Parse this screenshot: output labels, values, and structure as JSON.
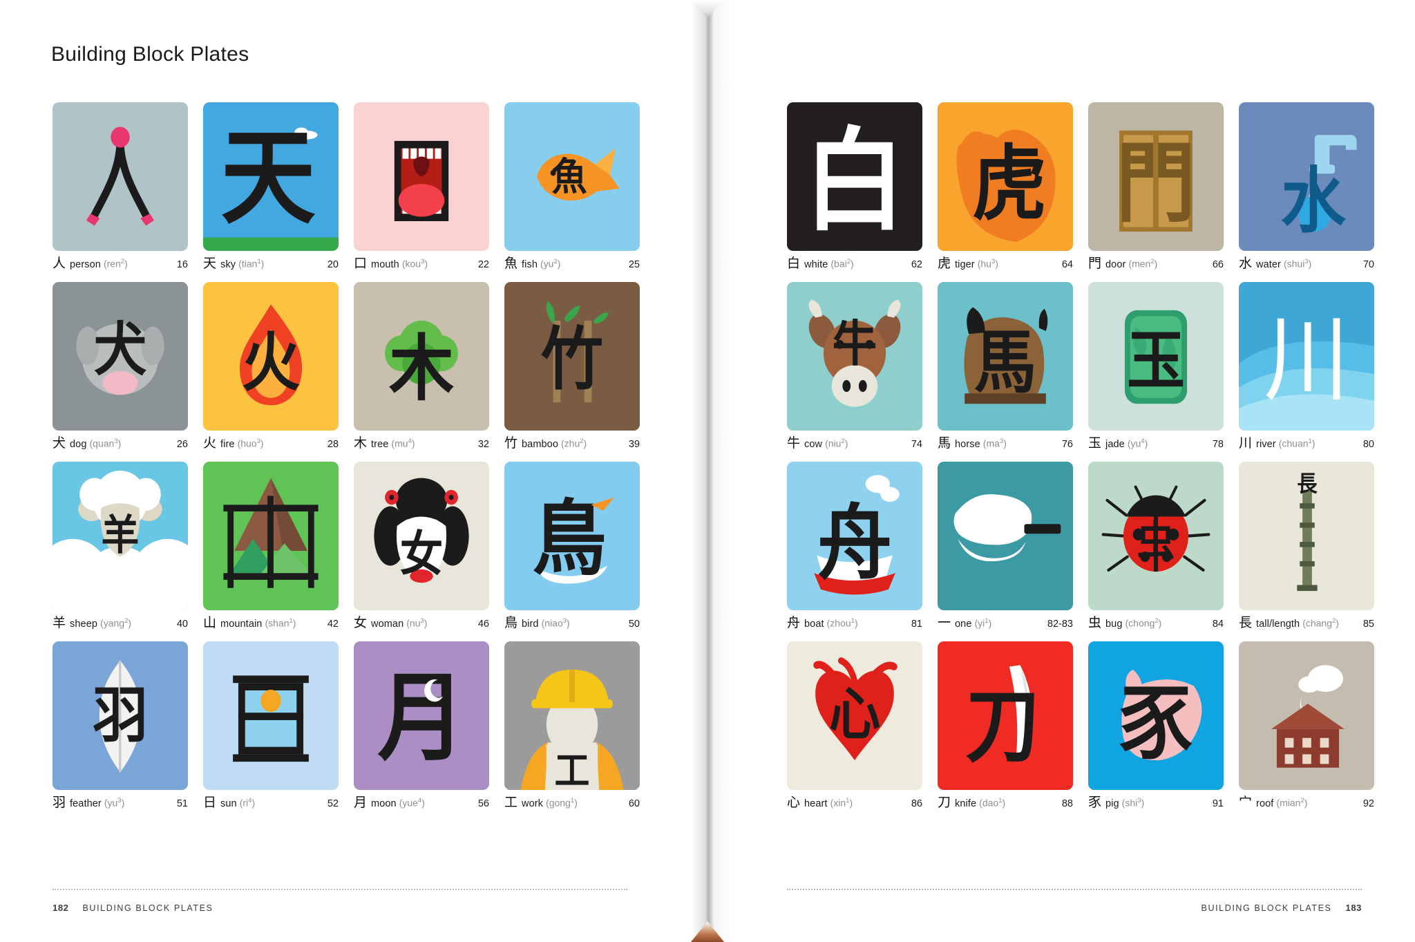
{
  "spread": {
    "title": "Building Block Plates",
    "left_page": {
      "folio": "182",
      "running_head": "BUILDING BLOCK PLATES"
    },
    "right_page": {
      "folio": "183",
      "running_head": "BUILDING BLOCK PLATES"
    }
  },
  "plates_left": [
    {
      "han": "人",
      "gloss": "person",
      "pinyin": "ren",
      "tone": "2",
      "page": "16",
      "icon": "person-tile",
      "bg": "#b0c3c6",
      "art": "person"
    },
    {
      "han": "天",
      "gloss": "sky",
      "pinyin": "tian",
      "tone": "1",
      "page": "20",
      "icon": "sky-tile",
      "bg": "#43a8e0",
      "art": "sky"
    },
    {
      "han": "口",
      "gloss": "mouth",
      "pinyin": "kou",
      "tone": "3",
      "page": "22",
      "icon": "mouth-tile",
      "bg": "#f9d3d2",
      "art": "mouth"
    },
    {
      "han": "魚",
      "gloss": "fish",
      "pinyin": "yu",
      "tone": "2",
      "page": "25",
      "icon": "fish-tile",
      "bg": "#87cdee",
      "art": "fish"
    },
    {
      "han": "犬",
      "gloss": "dog",
      "pinyin": "quan",
      "tone": "3",
      "page": "26",
      "icon": "dog-tile",
      "bg": "#8b9395",
      "art": "dog"
    },
    {
      "han": "火",
      "gloss": "fire",
      "pinyin": "huo",
      "tone": "3",
      "page": "28",
      "icon": "fire-tile",
      "bg": "#fbc33f",
      "art": "fire"
    },
    {
      "han": "木",
      "gloss": "tree",
      "pinyin": "mu",
      "tone": "4",
      "page": "32",
      "icon": "tree-tile",
      "bg": "#c9bfae",
      "art": "tree"
    },
    {
      "han": "竹",
      "gloss": "bamboo",
      "pinyin": "zhu",
      "tone": "2",
      "page": "39",
      "icon": "bamboo-tile",
      "bg": "#7a5c42",
      "art": "bamboo"
    },
    {
      "han": "羊",
      "gloss": "sheep",
      "pinyin": "yang",
      "tone": "2",
      "page": "40",
      "icon": "sheep-tile",
      "bg": "#69c6e4",
      "art": "sheep"
    },
    {
      "han": "山",
      "gloss": "mountain",
      "pinyin": "shan",
      "tone": "1",
      "page": "42",
      "icon": "mountain-tile",
      "bg": "#5fc356",
      "art": "mountain"
    },
    {
      "han": "女",
      "gloss": "woman",
      "pinyin": "nu",
      "tone": "3",
      "page": "46",
      "icon": "woman-tile",
      "bg": "#e8e5da",
      "art": "woman"
    },
    {
      "han": "鳥",
      "gloss": "bird",
      "pinyin": "niao",
      "tone": "3",
      "page": "50",
      "icon": "bird-tile",
      "bg": "#83ccf0",
      "art": "bird"
    },
    {
      "han": "羽",
      "gloss": "feather",
      "pinyin": "yu",
      "tone": "3",
      "page": "51",
      "icon": "feather-tile",
      "bg": "#7ba5d6",
      "art": "feather"
    },
    {
      "han": "日",
      "gloss": "sun",
      "pinyin": "ri",
      "tone": "4",
      "page": "52",
      "icon": "sun-tile",
      "bg": "#bfdcf4",
      "art": "sun"
    },
    {
      "han": "月",
      "gloss": "moon",
      "pinyin": "yue",
      "tone": "4",
      "page": "56",
      "icon": "moon-tile",
      "bg": "#ab8fc4",
      "art": "moon"
    },
    {
      "han": "工",
      "gloss": "work",
      "pinyin": "gong",
      "tone": "1",
      "page": "60",
      "icon": "work-tile",
      "bg": "#9b9b9b",
      "art": "work"
    }
  ],
  "plates_right": [
    {
      "han": "白",
      "gloss": "white",
      "pinyin": "bai",
      "tone": "2",
      "page": "62",
      "icon": "white-tile",
      "bg": "#231f20",
      "art": "white"
    },
    {
      "han": "虎",
      "gloss": "tiger",
      "pinyin": "hu",
      "tone": "3",
      "page": "64",
      "icon": "tiger-tile",
      "bg": "#f9a42c",
      "art": "tiger"
    },
    {
      "han": "門",
      "gloss": "door",
      "pinyin": "men",
      "tone": "2",
      "page": "66",
      "icon": "door-tile",
      "bg": "#bdb5a6",
      "art": "door"
    },
    {
      "han": "水",
      "gloss": "water",
      "pinyin": "shui",
      "tone": "3",
      "page": "70",
      "icon": "water-tile",
      "bg": "#6b8bbd",
      "art": "water"
    },
    {
      "han": "牛",
      "gloss": "cow",
      "pinyin": "niu",
      "tone": "2",
      "page": "74",
      "icon": "cow-tile",
      "bg": "#8ecfcd",
      "art": "cow"
    },
    {
      "han": "馬",
      "gloss": "horse",
      "pinyin": "ma",
      "tone": "3",
      "page": "76",
      "icon": "horse-tile",
      "bg": "#6cc0c9",
      "art": "horse"
    },
    {
      "han": "玉",
      "gloss": "jade",
      "pinyin": "yu",
      "tone": "4",
      "page": "78",
      "icon": "jade-tile",
      "bg": "#cde0dc",
      "art": "jade"
    },
    {
      "han": "川",
      "gloss": "river",
      "pinyin": "chuan",
      "tone": "1",
      "page": "80",
      "icon": "river-tile",
      "bg": "#3fa7d6",
      "art": "river"
    },
    {
      "han": "舟",
      "gloss": "boat",
      "pinyin": "zhou",
      "tone": "1",
      "page": "81",
      "icon": "boat-tile",
      "bg": "#8fd2ef",
      "art": "boat"
    },
    {
      "han": "一",
      "gloss": "one",
      "pinyin": "yi",
      "tone": "1",
      "page": "82-83",
      "icon": "one-tile",
      "bg": "#3b9aa4",
      "art": "one"
    },
    {
      "han": "虫",
      "gloss": "bug",
      "pinyin": "chong",
      "tone": "2",
      "page": "84",
      "icon": "bug-tile",
      "bg": "#bcd9c9",
      "art": "bug"
    },
    {
      "han": "長",
      "gloss": "tall/length",
      "pinyin": "chang",
      "tone": "2",
      "page": "85",
      "icon": "tall-length-tile",
      "bg": "#e9e6da",
      "art": "tall"
    },
    {
      "han": "心",
      "gloss": "heart",
      "pinyin": "xin",
      "tone": "1",
      "page": "86",
      "icon": "heart-tile",
      "bg": "#efeade",
      "art": "heart"
    },
    {
      "han": "刀",
      "gloss": "knife",
      "pinyin": "dao",
      "tone": "1",
      "page": "88",
      "icon": "knife-tile",
      "bg": "#ef2b24",
      "art": "knife"
    },
    {
      "han": "豕",
      "gloss": "pig",
      "pinyin": "shi",
      "tone": "3",
      "page": "91",
      "icon": "pig-tile",
      "bg": "#10a5e0",
      "art": "pig"
    },
    {
      "han": "宀",
      "gloss": "roof",
      "pinyin": "mian",
      "tone": "2",
      "page": "92",
      "icon": "roof-tile",
      "bg": "#c5bcb0",
      "art": "roof"
    }
  ]
}
